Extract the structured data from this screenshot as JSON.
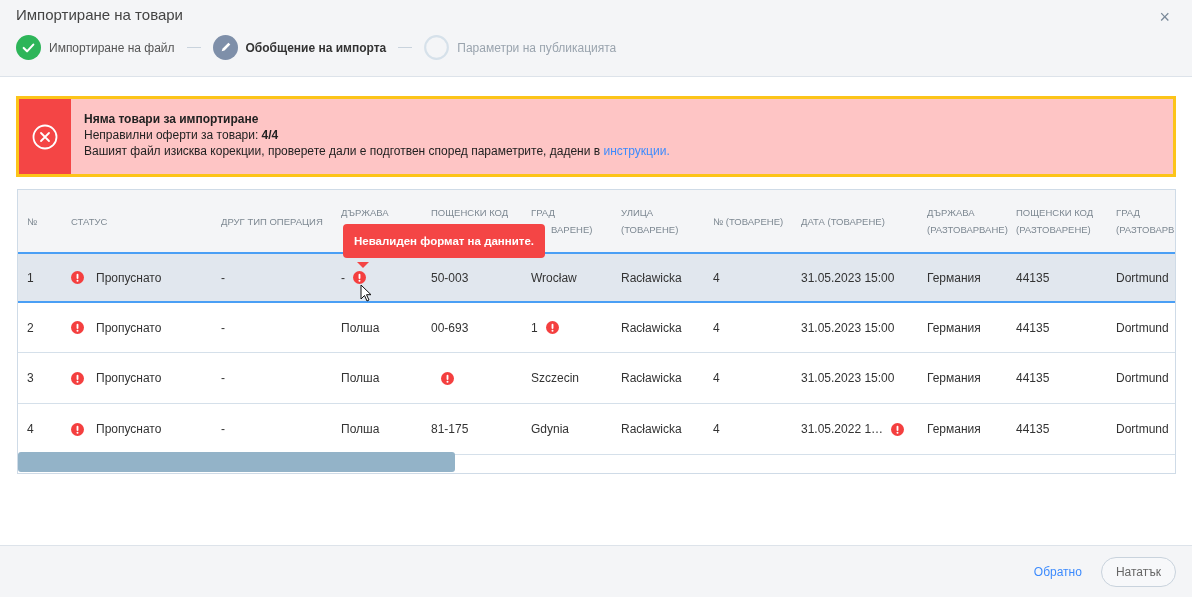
{
  "dialog": {
    "title": "Импортиране на товари",
    "close": "×"
  },
  "steps": [
    {
      "label": "Импортиране на файл",
      "completed": true,
      "selected": false
    },
    {
      "label": "Обобщение на импорта",
      "completed": false,
      "selected": true
    },
    {
      "label": "Параметри на публикацията",
      "completed": false,
      "selected": false
    }
  ],
  "alert": {
    "title": "Няма товари за импортиране",
    "line": "Неправилни оферти за товари: **4/4**",
    "text": "Вашият файл изисква корекции, проверете дали е подготвен според параметрите, дадени в",
    "link": "инструкции."
  },
  "table": {
    "columns": [
      {
        "lines": [
          "№"
        ]
      },
      {
        "lines": [
          "СТАТУС"
        ]
      },
      {
        "lines": [
          "ДРУГ ТИП ОПЕРАЦИЯ"
        ]
      },
      {
        "lines": [
          "ДЪРЖАВА"
        ],
        "second_line_covered": true
      },
      {
        "lines": [
          "ПОЩЕНСКИ КОД"
        ],
        "second_line_covered": true
      },
      {
        "lines": [
          "ГРАД"
        ],
        "cut_line": "ВАРЕНЕ)"
      },
      {
        "lines": [
          "УЛИЦА",
          "(ТОВАРЕНЕ)"
        ]
      },
      {
        "lines": [
          "№ (ТОВАРЕНЕ)"
        ]
      },
      {
        "lines": [
          "ДАТА (ТОВАРЕНЕ)"
        ]
      },
      {
        "lines": [
          "ДЪРЖАВА",
          "(РАЗТОВАРВАНЕ)"
        ]
      },
      {
        "lines": [
          "ПОЩЕНСКИ КОД",
          "(РАЗТОВАРЕНЕ)"
        ]
      },
      {
        "lines": [
          "ГРАД",
          "(РАЗТОВАРВ"
        ]
      }
    ],
    "rows": [
      {
        "selected": true,
        "cells": [
          {
            "text": "1",
            "error": false
          },
          {
            "kind": "status",
            "text": "Пропуснато",
            "error": true
          },
          {
            "text": "-",
            "error": false
          },
          {
            "text": "-",
            "error": true
          },
          {
            "text": "50-003",
            "error": false
          },
          {
            "text": "Wrocław",
            "error": false
          },
          {
            "text": "Racławicka",
            "error": false
          },
          {
            "text": "4",
            "error": false
          },
          {
            "text": "31.05.2023 15:00",
            "error": false
          },
          {
            "text": "Германия",
            "error": false
          },
          {
            "text": "44135",
            "error": false
          },
          {
            "text": "Dortmund",
            "error": false
          }
        ]
      },
      {
        "selected": false,
        "cells": [
          {
            "text": "2",
            "error": false
          },
          {
            "kind": "status",
            "text": "Пропуснато",
            "error": true
          },
          {
            "text": "-",
            "error": false
          },
          {
            "text": "Полша",
            "error": false
          },
          {
            "text": "00-693",
            "error": false
          },
          {
            "text": "1",
            "error": true
          },
          {
            "text": "Racławicka",
            "error": false
          },
          {
            "text": "4",
            "error": false
          },
          {
            "text": "31.05.2023 15:00",
            "error": false
          },
          {
            "text": "Германия",
            "error": false
          },
          {
            "text": "44135",
            "error": false
          },
          {
            "text": "Dortmund",
            "error": false
          }
        ]
      },
      {
        "selected": false,
        "cells": [
          {
            "text": "3",
            "error": false
          },
          {
            "kind": "status",
            "text": "Пропуснато",
            "error": true
          },
          {
            "text": "-",
            "error": false
          },
          {
            "text": "Полша",
            "error": false
          },
          {
            "error": true
          },
          {
            "text": "Szczecin",
            "error": false
          },
          {
            "text": "Racławicka",
            "error": false
          },
          {
            "text": "4",
            "error": false
          },
          {
            "text": "31.05.2023 15:00",
            "error": false
          },
          {
            "text": "Германия",
            "error": false
          },
          {
            "text": "44135",
            "error": false
          },
          {
            "text": "Dortmund",
            "error": false
          }
        ]
      },
      {
        "selected": false,
        "cells": [
          {
            "text": "4",
            "error": false
          },
          {
            "kind": "status",
            "text": "Пропуснато",
            "error": true
          },
          {
            "text": "-",
            "error": false
          },
          {
            "text": "Полша",
            "error": false
          },
          {
            "text": "81-175",
            "error": false
          },
          {
            "text": "Gdynia",
            "error": false
          },
          {
            "text": "Racławicka",
            "error": false
          },
          {
            "text": "4",
            "error": false
          },
          {
            "text": "31.05.2022 1…",
            "error": true
          },
          {
            "text": "Германия",
            "error": false
          },
          {
            "text": "44135",
            "error": false
          },
          {
            "text": "Dortmund",
            "error": false
          }
        ]
      }
    ],
    "tooltip": "Невалиден формат на данните."
  },
  "footer": {
    "back": "Обратно",
    "next": {
      "label": "Нататък",
      "disabled": true
    }
  }
}
